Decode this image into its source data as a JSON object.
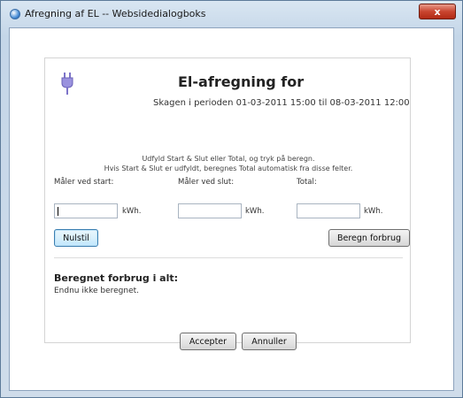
{
  "window": {
    "title": "Afregning af EL -- Websidedialogboks",
    "close_label": "x"
  },
  "dialog": {
    "heading": "El-afregning for",
    "subheading": "Skagen i perioden 01-03-2011 15:00 til 08-03-2011 12:00",
    "instructions": [
      "Udfyld Start & Slut eller Total, og tryk på beregn.",
      "Hvis Start & Slut er udfyldt, beregnes Total automatisk fra disse felter."
    ],
    "fields": {
      "start": {
        "label": "Måler ved start:",
        "value": "",
        "unit": "kWh."
      },
      "end": {
        "label": "Måler ved slut:",
        "value": "",
        "unit": "kWh."
      },
      "total": {
        "label": "Total:",
        "value": "",
        "unit": "kWh."
      }
    },
    "buttons": {
      "reset": "Nulstil",
      "calculate": "Beregn forbrug",
      "accept": "Accepter",
      "cancel": "Annuller"
    },
    "result": {
      "title": "Beregnet forbrug i alt:",
      "text": "Endnu ikke beregnet."
    }
  },
  "icons": {
    "plug": "plug-icon",
    "app": "ie-icon"
  },
  "colors": {
    "plug": "#7d74c9",
    "close_button": "#c9452f"
  }
}
